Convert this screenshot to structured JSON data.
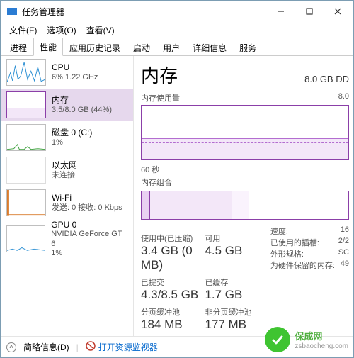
{
  "window": {
    "title": "任务管理器"
  },
  "menu": {
    "file": "文件(F)",
    "options": "选项(O)",
    "view": "查看(V)"
  },
  "tabs": {
    "processes": "进程",
    "performance": "性能",
    "app_history": "应用历史记录",
    "startup": "启动",
    "users": "用户",
    "details": "详细信息",
    "services": "服务"
  },
  "sidebar": {
    "cpu": {
      "label": "CPU",
      "sub": "6%  1.22 GHz"
    },
    "memory": {
      "label": "内存",
      "sub": "3.5/8.0 GB (44%)"
    },
    "disk": {
      "label": "磁盘 0 (C:)",
      "sub": "1%"
    },
    "eth": {
      "label": "以太网",
      "sub": "未连接"
    },
    "wifi": {
      "label": "Wi-Fi",
      "sub": "发送: 0 接收: 0 Kbps"
    },
    "gpu": {
      "label": "GPU 0",
      "sub": "NVIDIA GeForce GT 6",
      "sub2": "1%"
    }
  },
  "main": {
    "title": "内存",
    "capacity": "8.0 GB DD",
    "usage_label": "内存使用量",
    "usage_right": "8.0",
    "timescale": "60 秒",
    "comp_label": "内存组合",
    "stats": {
      "in_use_k": "使用中(已压缩)",
      "in_use_v": "3.4 GB (0 MB)",
      "avail_k": "可用",
      "avail_v": "4.5 GB",
      "commit_k": "已提交",
      "commit_v": "4.3/8.5 GB",
      "cached_k": "已缓存",
      "cached_v": "1.7 GB",
      "paged_k": "分页缓冲池",
      "paged_v": "184 MB",
      "nonpaged_k": "非分页缓冲池",
      "nonpaged_v": "177 MB"
    },
    "details": {
      "speed_k": "速度:",
      "speed_v": "16",
      "slots_k": "已使用的插槽:",
      "slots_v": "2/2",
      "form_k": "外形规格:",
      "form_v": "SC",
      "hw_k": "为硬件保留的内存:",
      "hw_v": "49"
    }
  },
  "footer": {
    "less": "简略信息(D)",
    "monitor": "打开资源监视器"
  },
  "watermark": {
    "brand": "保成网",
    "url": "zsbaocheng.com"
  }
}
